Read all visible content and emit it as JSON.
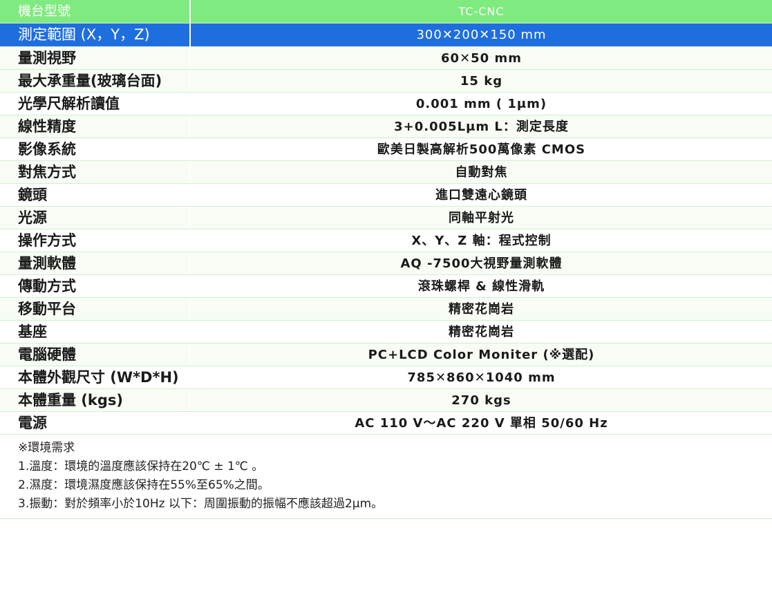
{
  "header": {
    "label": "機台型號",
    "value": "TC-CNC"
  },
  "rows": [
    {
      "label": "測定範圍 (X，Y，Z)",
      "value": "300✕200✕150 mm"
    },
    {
      "label": "量測視野",
      "value": "60✕50 mm"
    },
    {
      "label": "最大承重量(玻璃台面)",
      "value": "15 kg"
    },
    {
      "label": "光學尺解析讀值",
      "value": "0.001 mm ( 1μm)"
    },
    {
      "label": "線性精度",
      "value": "3+0.005Lμm L：測定長度"
    },
    {
      "label": "影像系統",
      "value": "歐美日製高解析500萬像素 CMOS"
    },
    {
      "label": "對焦方式",
      "value": "自動對焦"
    },
    {
      "label": "鏡頭",
      "value": "進口雙遠心鏡頭"
    },
    {
      "label": "光源",
      "value": "同軸平射光"
    },
    {
      "label": "操作方式",
      "value": "X、Y、Z 軸：程式控制"
    },
    {
      "label": "量測軟體",
      "value": "AQ -7500大視野量測軟體"
    },
    {
      "label": "傳動方式",
      "value": "滾珠螺桿 & 線性滑軌"
    },
    {
      "label": "移動平台",
      "value": "精密花崗岩"
    },
    {
      "label": "基座",
      "value": "精密花崗岩"
    },
    {
      "label": "電腦硬體",
      "value": "PC+LCD Color Moniter (※選配)"
    },
    {
      "label": "本體外觀尺寸 (W*D*H)",
      "value": "785✕860✕1040 mm"
    },
    {
      "label": "本體重量 (kgs)",
      "value": "270 kgs"
    },
    {
      "label": "電源",
      "value": "AC 110 V～AC 220 V 單相 50/60 Hz"
    }
  ],
  "notes": {
    "title": "※環境需求",
    "lines": [
      "1.溫度：環境的溫度應該保持在20℃ ± 1℃ 。",
      "2.濕度：環境濕度應該保持在55%至65%之間。",
      "3.振動：對於頻率小於10Hz 以下：周圍振動的振幅不應該超過2μm。"
    ]
  },
  "colors": {
    "header_bg": "#7fea7f",
    "selected_bg": "#1f6ee0",
    "stripe_bg": "#f7fdf4",
    "divider": "#cfeecf"
  }
}
